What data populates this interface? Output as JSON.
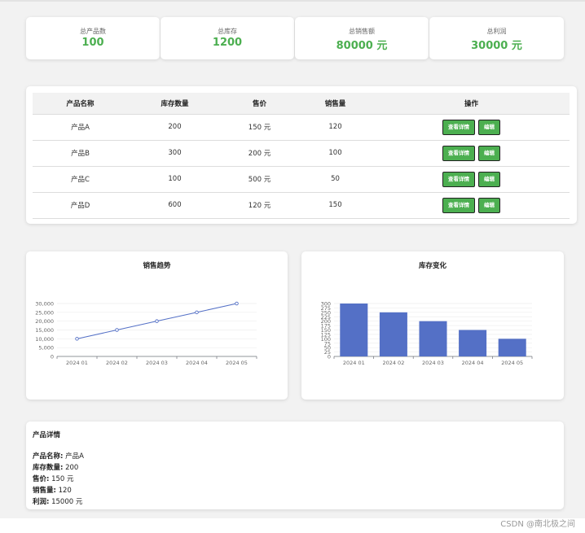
{
  "stats": [
    {
      "label": "总产品数",
      "value": "100"
    },
    {
      "label": "总库存",
      "value": "1200"
    },
    {
      "label": "总销售额",
      "value": "80000 元"
    },
    {
      "label": "总利润",
      "value": "30000 元"
    }
  ],
  "table": {
    "headers": [
      "产品名称",
      "库存数量",
      "售价",
      "销售量",
      "操作"
    ],
    "rows": [
      {
        "name": "产品A",
        "stock": "200",
        "price": "150 元",
        "sales": "120"
      },
      {
        "name": "产品B",
        "stock": "300",
        "price": "200 元",
        "sales": "100"
      },
      {
        "name": "产品C",
        "stock": "100",
        "price": "500 元",
        "sales": "50"
      },
      {
        "name": "产品D",
        "stock": "600",
        "price": "120 元",
        "sales": "150"
      }
    ],
    "view_label": "查看详情",
    "edit_label": "编辑"
  },
  "chart_data": [
    {
      "type": "line",
      "title": "销售趋势",
      "categories": [
        "2024 01",
        "2024 02",
        "2024 03",
        "2024 04",
        "2024 05"
      ],
      "values": [
        10000,
        15000,
        20000,
        25000,
        30000
      ],
      "ylim": [
        0,
        30000
      ],
      "yticks": [
        "0",
        "5,000",
        "10,000",
        "15,000",
        "20,000",
        "25,000",
        "30,000"
      ],
      "color": "#5470c6"
    },
    {
      "type": "bar",
      "title": "库存变化",
      "categories": [
        "2024 01",
        "2024 02",
        "2024 03",
        "2024 04",
        "2024 05"
      ],
      "values": [
        300,
        250,
        200,
        150,
        100
      ],
      "ylim": [
        0,
        300
      ],
      "yticks": [
        "0",
        "25",
        "50",
        "75",
        "100",
        "125",
        "150",
        "175",
        "200",
        "225",
        "250",
        "275",
        "300"
      ],
      "color": "#5470c6"
    }
  ],
  "details": {
    "title": "产品详情",
    "rows": [
      {
        "label": "产品名称:",
        "value": "产品A"
      },
      {
        "label": "库存数量:",
        "value": "200"
      },
      {
        "label": "售价:",
        "value": "150 元"
      },
      {
        "label": "销售量:",
        "value": "120"
      },
      {
        "label": "利润:",
        "value": "15000 元"
      }
    ]
  },
  "watermark": "CSDN @南北极之间"
}
